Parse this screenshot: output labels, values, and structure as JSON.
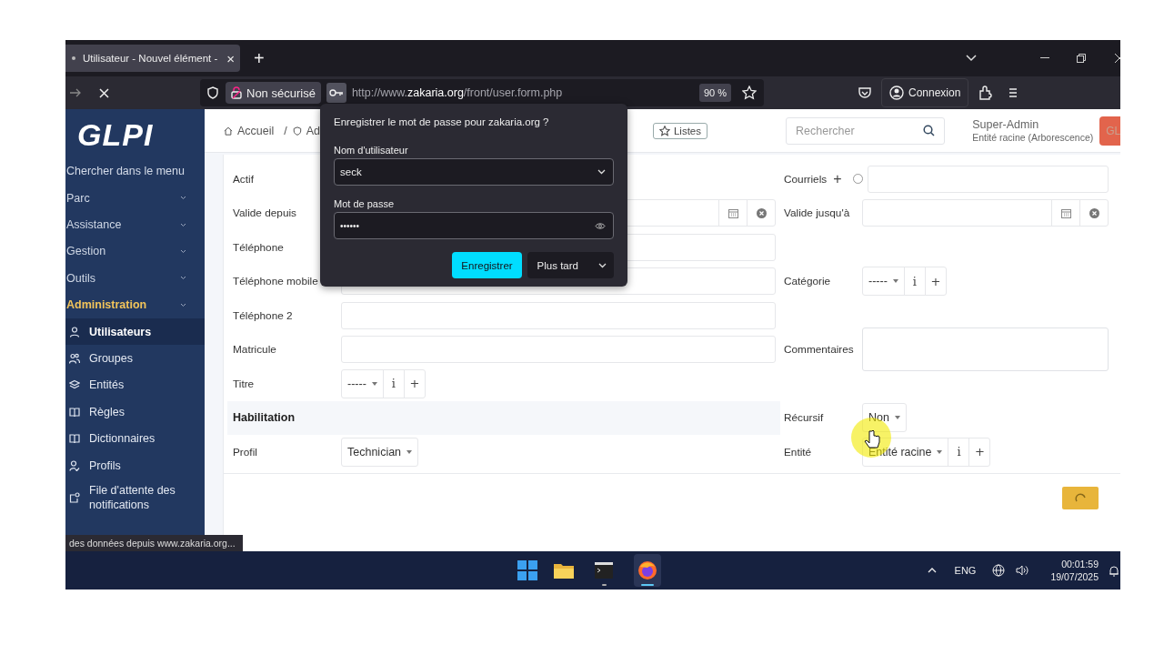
{
  "browser": {
    "tab_title": "Utilisateur - Nouvel élément -",
    "tab_close": "×",
    "new_tab": "+",
    "security": "Non sécurisé",
    "url_prefix": "http://www.",
    "url_host": "zakaria.org",
    "url_path": "/front/user.form.php",
    "zoom": "90 %",
    "account": "Connexion"
  },
  "sidebar": {
    "logo": "GLPI",
    "search": "Chercher dans le menu",
    "items": [
      {
        "label": "Parc",
        "active": false
      },
      {
        "label": "Assistance",
        "active": false
      },
      {
        "label": "Gestion",
        "active": false
      },
      {
        "label": "Outils",
        "active": false
      },
      {
        "label": "Administration",
        "active": true,
        "children": [
          {
            "label": "Utilisateurs",
            "selected": true
          },
          {
            "label": "Groupes",
            "selected": false
          },
          {
            "label": "Entités",
            "selected": false
          },
          {
            "label": "Règles",
            "selected": false
          },
          {
            "label": "Dictionnaires",
            "selected": false
          },
          {
            "label": "Profils",
            "selected": false
          },
          {
            "label": "File d'attente des notifications",
            "selected": false
          }
        ]
      }
    ]
  },
  "header": {
    "breadcrumb": [
      "Accueil",
      "/",
      "Ad"
    ],
    "lists_button": "Listes",
    "search_placeholder": "Rechercher",
    "user_name": "Super-Admin",
    "user_entity": "Entité racine (Arborescence)",
    "avatar": "GL"
  },
  "form": {
    "rows": [
      {
        "left": {
          "label": "Actif"
        },
        "right": {
          "label": "Courriels",
          "label_add": "+",
          "field": {
            "kind": "email",
            "default": false
          }
        }
      },
      {
        "left": {
          "label": "Valide depuis",
          "field": {
            "kind": "date"
          }
        },
        "right": {
          "label": "Valide jusqu'à",
          "field": {
            "kind": "date"
          }
        }
      },
      {
        "left": {
          "label": "Téléphone",
          "field": {
            "kind": "text"
          }
        }
      },
      {
        "left": {
          "label": "Téléphone mobile",
          "field": {
            "kind": "text"
          }
        },
        "right": {
          "label": "Catégorie",
          "field": {
            "kind": "dropdown",
            "value": "-----",
            "info": "i",
            "add": "+"
          }
        }
      },
      {
        "left": {
          "label": "Téléphone 2",
          "field": {
            "kind": "text"
          }
        }
      },
      {
        "left": {
          "label": "Matricule",
          "field": {
            "kind": "text"
          }
        },
        "right": {
          "label": "Commentaires",
          "field": {
            "kind": "textarea"
          }
        }
      },
      {
        "left": {
          "label": "Titre",
          "field": {
            "kind": "dropdown",
            "value": "-----",
            "info": "i",
            "add": "+"
          }
        }
      },
      {
        "left": {
          "label": "Habilitation",
          "kind": "section"
        },
        "right": {
          "label": "Récursif",
          "field": {
            "kind": "dropdown",
            "value": "Non"
          }
        }
      },
      {
        "left": {
          "label": "Profil",
          "field": {
            "kind": "dropdown",
            "value": "Technician"
          }
        },
        "right": {
          "label": "Entité",
          "field": {
            "kind": "dropdown",
            "value": "Entité racine",
            "info": "i",
            "add": "+"
          }
        }
      }
    ]
  },
  "password_popup": {
    "title": "Enregistrer le mot de passe pour zakaria.org ?",
    "username_label": "Nom d'utilisateur",
    "username": "seck",
    "password_label": "Mot de passe",
    "password": "••••••",
    "save_button": "Enregistrer",
    "later_button": "Plus tard"
  },
  "status_tooltip": "des données depuis www.zakaria.org...",
  "taskbar": {
    "language": "ENG",
    "time": "00:01:59",
    "date": "19/07/2025"
  }
}
